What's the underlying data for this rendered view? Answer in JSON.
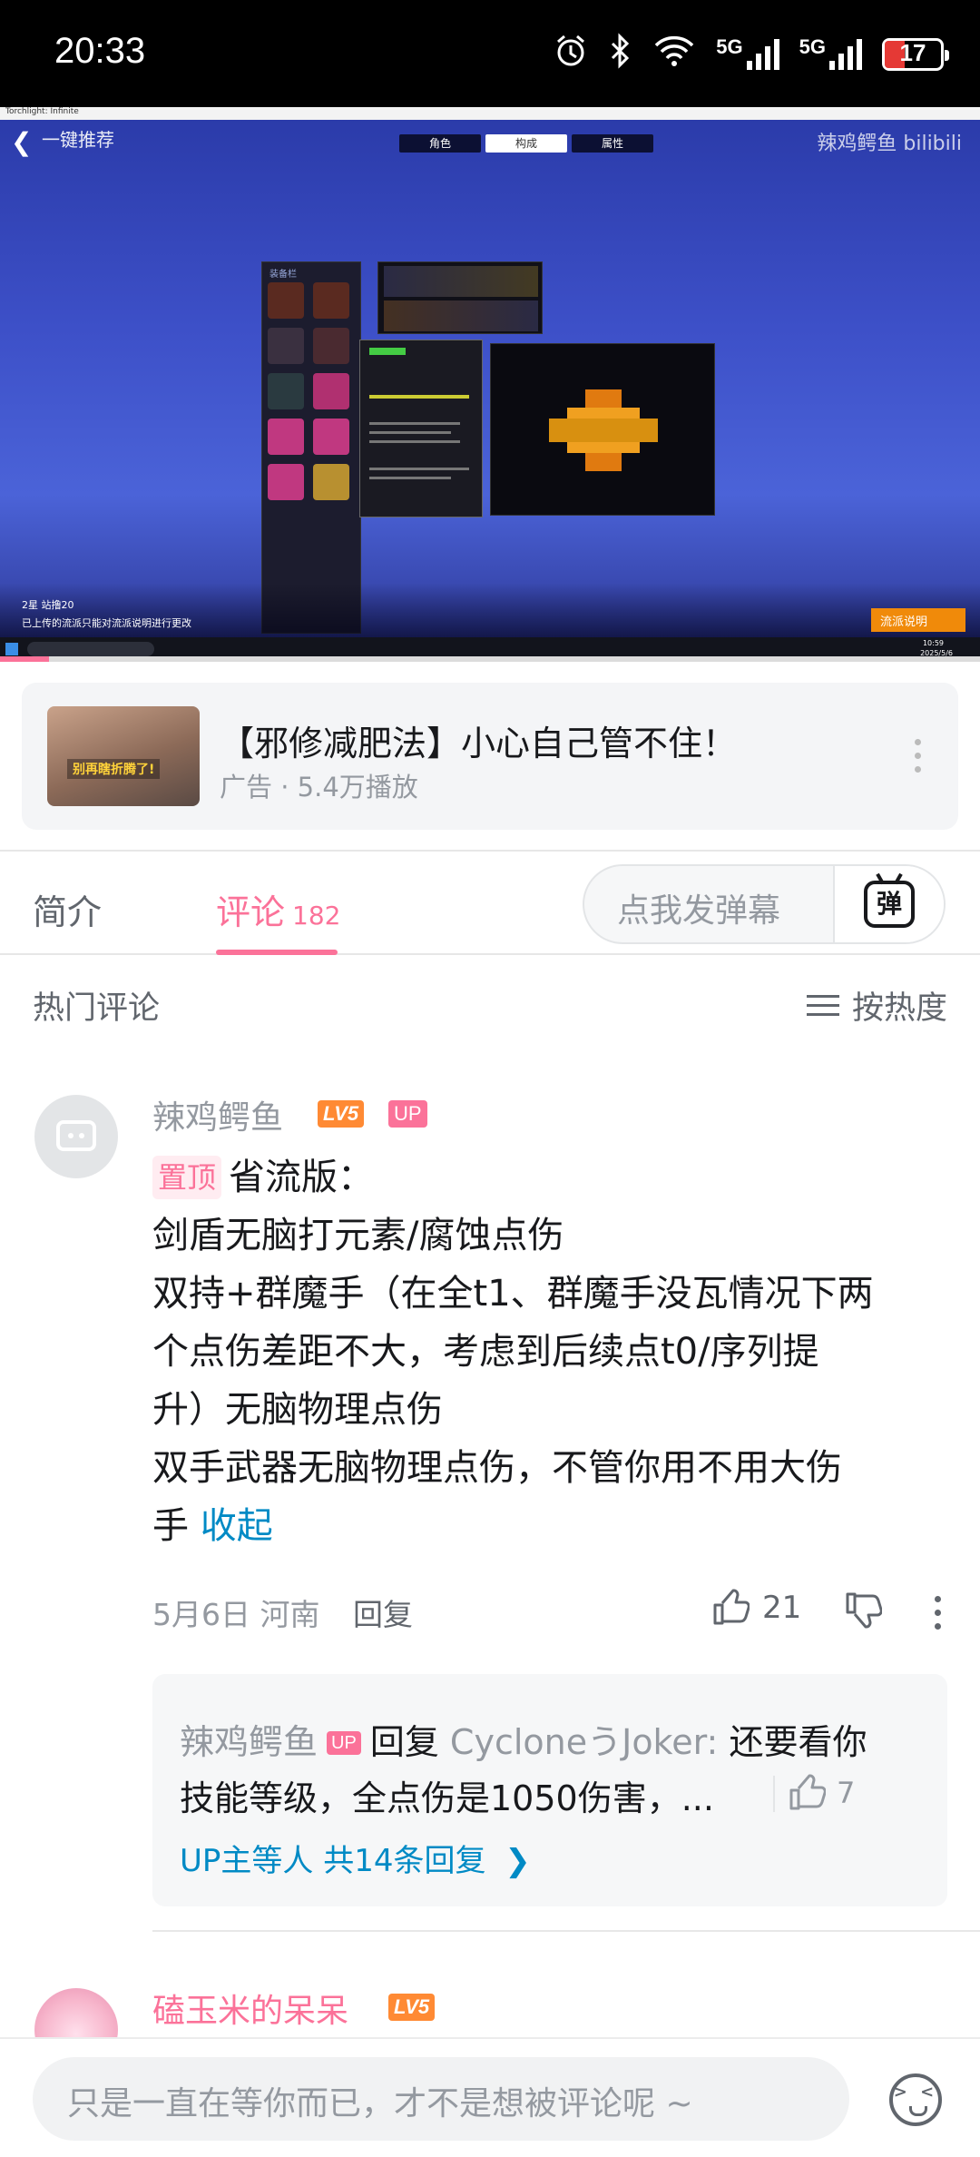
{
  "status_bar": {
    "time": "20:33",
    "network_1": "5G",
    "network_2": "5G",
    "battery": "17",
    "icons": [
      "alarm-icon",
      "bluetooth-icon",
      "wifi-icon",
      "signal-icon",
      "signal-icon",
      "battery-icon"
    ]
  },
  "video": {
    "window_title": "Torchlight: Infinite",
    "game_title": "一键推荐",
    "tabs": [
      "角色",
      "构成",
      "属性"
    ],
    "active_tab": 1,
    "watermark": "辣鸡鳄鱼 bilibili",
    "panel_label": "装备栏",
    "overlay_text_1": "2星 站撸20",
    "overlay_text_2": "已上传的流派只能对流派说明进行更改",
    "action_button": "流派说明",
    "taskbar_time": "10:59",
    "taskbar_date": "2025/5/6",
    "progress": 0.05
  },
  "ad": {
    "thumb_caption": "别再瞎折腾了!",
    "title": "【邪修减肥法】小心自己管不住！",
    "meta": "广告 · 5.4万播放"
  },
  "tabs": {
    "intro": "简介",
    "comments": "评论",
    "comment_count": "182",
    "danmaku_placeholder": "点我发弹幕",
    "danmaku_button": "弹"
  },
  "comments_header": {
    "title": "热门评论",
    "sort_label": "按热度"
  },
  "comment": {
    "username": "辣鸡鳄鱼",
    "level": "LV5",
    "up_badge": "UP",
    "pinned": "置顶",
    "lines": [
      "省流版：",
      "剑盾无脑打元素/腐蚀点伤",
      "双持+群魔手（在全t1、群魔手没瓦情况下两",
      "个点伤差距不大，考虑到后续点t0/序列提",
      "升）无脑物理点伤",
      "双手武器无脑物理点伤，不管你用不用大伤",
      "手"
    ],
    "collapse": "收起",
    "date": "5月6日",
    "location": "河南",
    "reply_label": "回复",
    "likes": "21",
    "reply": {
      "username": "辣鸡鳄鱼",
      "up_badge": "UP",
      "reply_word": "回复",
      "target": "CycloneうJoker:",
      "text_1": "还要看你",
      "text_2": "技能等级，全点伤是1050伤害，...",
      "likes": "7",
      "more": "UP主等人 共14条回复"
    }
  },
  "comment2": {
    "username": "磕玉米的呆呆",
    "level": "LV5"
  },
  "bottom": {
    "placeholder": "只是一直在等你而已，才不是想被评论呢 ~"
  },
  "colors": {
    "accent": "#fb7299",
    "link": "#008ac5",
    "level": "#ff8a34"
  }
}
